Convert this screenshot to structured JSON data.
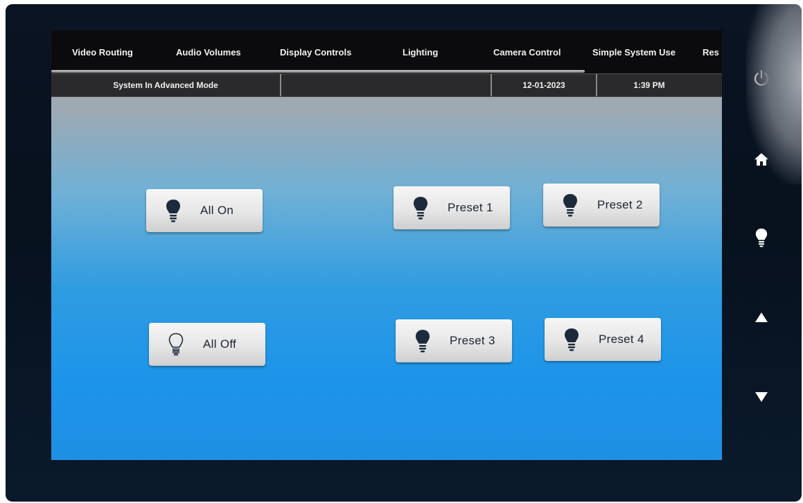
{
  "nav": {
    "tabs": [
      {
        "label": "Video Routing"
      },
      {
        "label": "Audio Volumes"
      },
      {
        "label": "Display Controls"
      },
      {
        "label": "Lighting"
      },
      {
        "label": "Camera Control"
      },
      {
        "label": "Simple System Use"
      },
      {
        "label": "Res"
      }
    ]
  },
  "status": {
    "mode": "System In Advanced Mode",
    "blank": "",
    "date": "12-01-2023",
    "time": "1:39 PM"
  },
  "lighting": {
    "all_on": "All On",
    "all_off": "All Off",
    "preset1": "Preset 1",
    "preset2": "Preset 2",
    "preset3": "Preset 3",
    "preset4": "Preset 4"
  },
  "icons": {
    "bulb_filled": "lightbulb-filled-icon",
    "bulb_outline": "lightbulb-outline-icon",
    "power": "power-icon",
    "home": "home-icon",
    "bulb_side": "lightbulb-icon",
    "up": "arrow-up-icon",
    "down": "arrow-down-icon"
  },
  "colors": {
    "icon_dark": "#1c2a3c",
    "side_icon": "#ffffff",
    "nav_bg": "#0b0b0d"
  }
}
